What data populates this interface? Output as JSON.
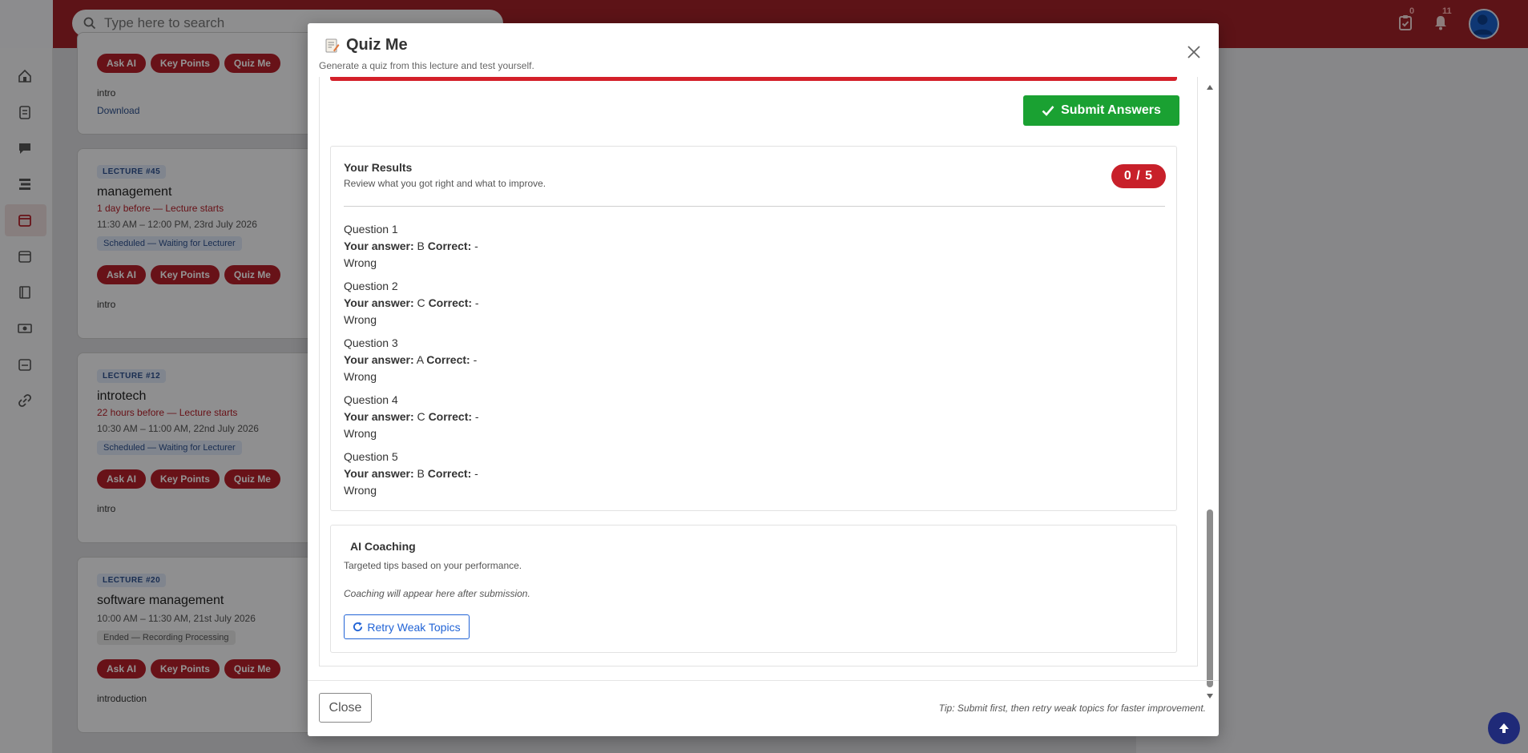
{
  "header": {
    "search_placeholder": "Type here to search",
    "tasks_count": "0",
    "notifications_count": "11"
  },
  "background": {
    "chips": {
      "ask_ai": "Ask AI",
      "key_points": "Key Points",
      "quiz_me": "Quiz Me"
    },
    "card0": {
      "note": "intro",
      "download": "Download"
    },
    "lectures": [
      {
        "tag": "LECTURE #45",
        "title": "management",
        "warn": "1 day before — Lecture starts",
        "time": "11:30 AM – 12:00 PM, 23rd July 2026",
        "status": "Scheduled — Waiting for Lecturer",
        "note": "intro"
      },
      {
        "tag": "LECTURE #12",
        "title": "introtech",
        "warn": "22 hours before — Lecture starts",
        "time": "10:30 AM – 11:00 AM, 22nd July 2026",
        "status": "Scheduled — Waiting for Lecturer",
        "note": "intro"
      },
      {
        "tag": "LECTURE #20",
        "title": "software management",
        "warn": "",
        "time": "10:00 AM – 11:30 AM, 21st July 2026",
        "status": "Ended — Recording Processing",
        "note": "introduction"
      }
    ]
  },
  "modal": {
    "title": "Quiz Me",
    "subtitle": "Generate a quiz from this lecture and test yourself.",
    "submit_label": "Submit Answers",
    "results": {
      "title": "Your Results",
      "subtitle": "Review what you got right and what to improve.",
      "score": "0 / 5",
      "answer_label": "Your answer:",
      "correct_label": "Correct:",
      "questions": [
        {
          "label": "Question 1",
          "answer": "B",
          "correct": "-",
          "verdict": "Wrong"
        },
        {
          "label": "Question 2",
          "answer": "C",
          "correct": "-",
          "verdict": "Wrong"
        },
        {
          "label": "Question 3",
          "answer": "A",
          "correct": "-",
          "verdict": "Wrong"
        },
        {
          "label": "Question 4",
          "answer": "C",
          "correct": "-",
          "verdict": "Wrong"
        },
        {
          "label": "Question 5",
          "answer": "B",
          "correct": "-",
          "verdict": "Wrong"
        }
      ]
    },
    "coaching": {
      "title": "AI Coaching",
      "subtitle": "Targeted tips based on your performance.",
      "note": "Coaching will appear here after submission.",
      "retry_label": "Retry Weak Topics"
    },
    "footer": {
      "close_label": "Close",
      "tip": "Tip: Submit first, then retry weak topics for faster improvement."
    }
  },
  "colors": {
    "brand": "#a02128",
    "success": "#1aa132",
    "danger": "#c8202a",
    "link": "#2264d6"
  },
  "icons": [
    "search-icon",
    "clipboard-check-icon",
    "bell-icon",
    "user-avatar-icon",
    "home-icon",
    "memo-icon",
    "close-icon",
    "check-icon",
    "refresh-icon",
    "arrow-up-icon"
  ]
}
